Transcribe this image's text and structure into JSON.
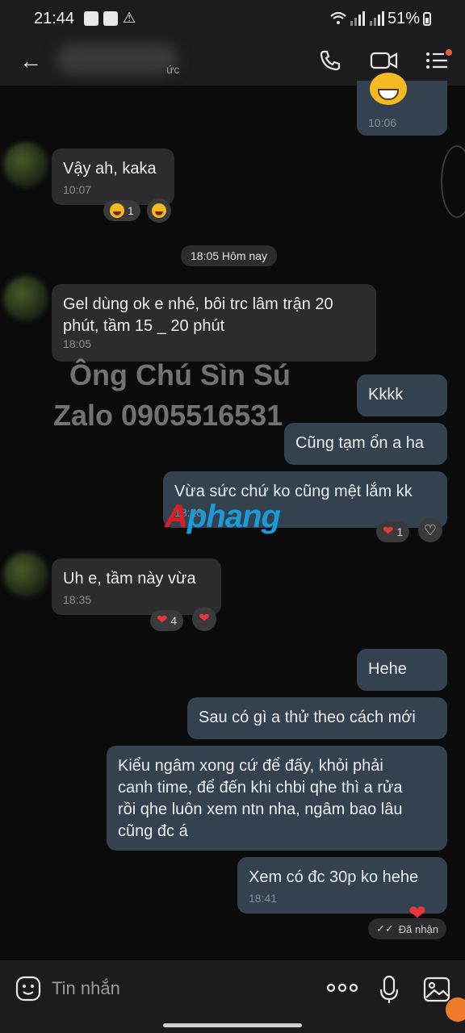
{
  "status_bar": {
    "time": "21:44",
    "battery": "51%"
  },
  "header": {
    "contact_sub": "ức",
    "icons": [
      "back-arrow-icon",
      "phone-icon",
      "video-call-icon",
      "menu-list-icon"
    ]
  },
  "date_separator": "18:05 Hôm nay",
  "messages": [
    {
      "dir": "out",
      "text": "",
      "time": "10:06",
      "emoji": "grinning-face"
    },
    {
      "dir": "in",
      "text": "Vậy ah, kaka",
      "time": "10:07",
      "reaction": {
        "count": "1"
      }
    },
    {
      "dir": "in",
      "text": "Gel dùng ok e nhé, bôi trc lâm trận 20\nphút, tầm 15 _ 20 phút",
      "time": "18:05"
    },
    {
      "dir": "out",
      "text": "Kkkk"
    },
    {
      "dir": "out",
      "text": "Cũng tạm ổn a ha"
    },
    {
      "dir": "out",
      "text": "Vừa sức chứ ko cũng mệt lắm kk",
      "time": "18:20",
      "reaction": {
        "count": "1"
      }
    },
    {
      "dir": "in",
      "text": "Uh e, tầm này vừa",
      "time": "18:35",
      "reaction": {
        "count": "4"
      }
    },
    {
      "dir": "out",
      "text": "Hehe"
    },
    {
      "dir": "out",
      "text": "Sau có gì a thử theo cách mới"
    },
    {
      "dir": "out",
      "text": "Kiểu ngâm xong cứ để đấy, khỏi phải\ncanh time, để đến khi chbi qhe thì a rửa\nrồi qhe luôn xem ntn nha, ngâm bao lâu\ncũng đc á"
    },
    {
      "dir": "out",
      "text": "Xem có đc 30p ko hehe",
      "time": "18:41"
    }
  ],
  "delivery_status": "Đã nhận",
  "watermarks": {
    "line1": "Ông Chú Sìn Sú",
    "line2": "Zalo 0905516531",
    "logo_red": "A",
    "logo_blue": "phang"
  },
  "input": {
    "placeholder": "Tin nhắn"
  },
  "colors": {
    "incoming": "#2c2c2e",
    "outgoing": "#34424f",
    "background": "#0b0b0c",
    "heart": "#e8373a"
  }
}
